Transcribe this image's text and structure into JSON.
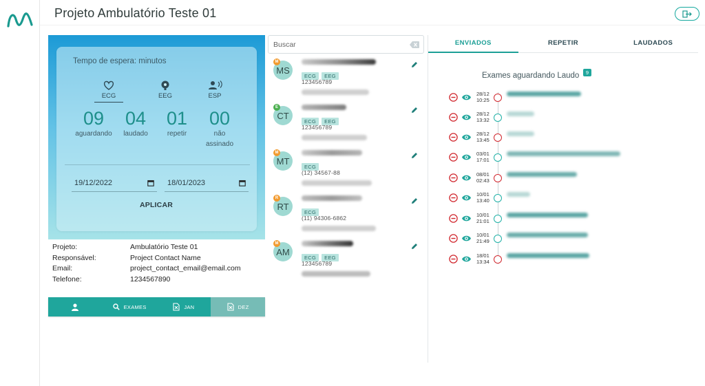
{
  "header": {
    "title": "Projeto Ambulatório Teste 01",
    "logo_icon": "wave-logo-icon",
    "logout_icon": "logout-icon"
  },
  "stats": {
    "wait_label": "Tempo de espera: minutos",
    "types": [
      {
        "label": "ECG",
        "icon": "heart-icon",
        "active": true
      },
      {
        "label": "EEG",
        "icon": "brain-icon",
        "active": false
      },
      {
        "label": "ESP",
        "icon": "voice-icon",
        "active": false
      }
    ],
    "counts": [
      {
        "value": "09",
        "label": "aguardando"
      },
      {
        "value": "04",
        "label": "laudado"
      },
      {
        "value": "01",
        "label": "repetir"
      },
      {
        "value": "00",
        "label": "não assinado"
      }
    ],
    "date_from": "19/12/2022",
    "date_to": "18/01/2023",
    "apply_label": "APLICAR"
  },
  "project_info": [
    {
      "key": "Projeto:",
      "value": "Ambulatório Teste 01"
    },
    {
      "key": "Responsável:",
      "value": "Project Contact Name"
    },
    {
      "key": "Email:",
      "value": "project_contact_email@email.com"
    },
    {
      "key": "Telefone:",
      "value": "1234567890"
    }
  ],
  "bottom_nav": [
    {
      "label": "",
      "icon": "user-icon",
      "active": false
    },
    {
      "label": "EXAMES",
      "icon": "search-icon",
      "active": false
    },
    {
      "label": "JAN",
      "icon": "excel-file-icon",
      "active": false
    },
    {
      "label": "DEZ",
      "icon": "excel-file-icon",
      "active": true
    }
  ],
  "search": {
    "placeholder": "Buscar",
    "value": ""
  },
  "patients": [
    {
      "initials": "MS",
      "badge": "M",
      "badge_color": "#f29a2e",
      "tags": [
        "ECG",
        "EEG"
      ],
      "id": "123456789"
    },
    {
      "initials": "CT",
      "badge": "E",
      "badge_color": "#4caf50",
      "tags": [
        "ECG",
        "EEG"
      ],
      "id": "123456789"
    },
    {
      "initials": "MT",
      "badge": "M",
      "badge_color": "#f29a2e",
      "tags": [
        "ECG"
      ],
      "id": "(12) 34567-88"
    },
    {
      "initials": "RT",
      "badge": "R",
      "badge_color": "#f29a2e",
      "tags": [
        "ECG"
      ],
      "id": "(11) 94306-6862"
    },
    {
      "initials": "AM",
      "badge": "M",
      "badge_color": "#f29a2e",
      "tags": [
        "ECG",
        "EEG"
      ],
      "id": "123456789"
    }
  ],
  "tabs": [
    {
      "label": "ENVIADOS",
      "active": true
    },
    {
      "label": "REPETIR",
      "active": false
    },
    {
      "label": "LAUDADOS",
      "active": false
    }
  ],
  "timeline": {
    "title": "Exames aguardando Laudo",
    "count": "9",
    "items": [
      {
        "date": "28/12",
        "time": "10:25",
        "status": "red"
      },
      {
        "date": "28/12",
        "time": "13:32",
        "status": "teal"
      },
      {
        "date": "28/12",
        "time": "13:45",
        "status": "red"
      },
      {
        "date": "03/01",
        "time": "17:01",
        "status": "teal"
      },
      {
        "date": "08/01",
        "time": "02:43",
        "status": "red"
      },
      {
        "date": "10/01",
        "time": "13:40",
        "status": "teal"
      },
      {
        "date": "10/01",
        "time": "21:01",
        "status": "teal"
      },
      {
        "date": "10/01",
        "time": "21:49",
        "status": "teal"
      },
      {
        "date": "18/01",
        "time": "13:34",
        "status": "red"
      }
    ]
  },
  "colors": {
    "accent": "#1fa69c",
    "status_red": "#d0262d",
    "status_teal": "#1fb0a6"
  }
}
